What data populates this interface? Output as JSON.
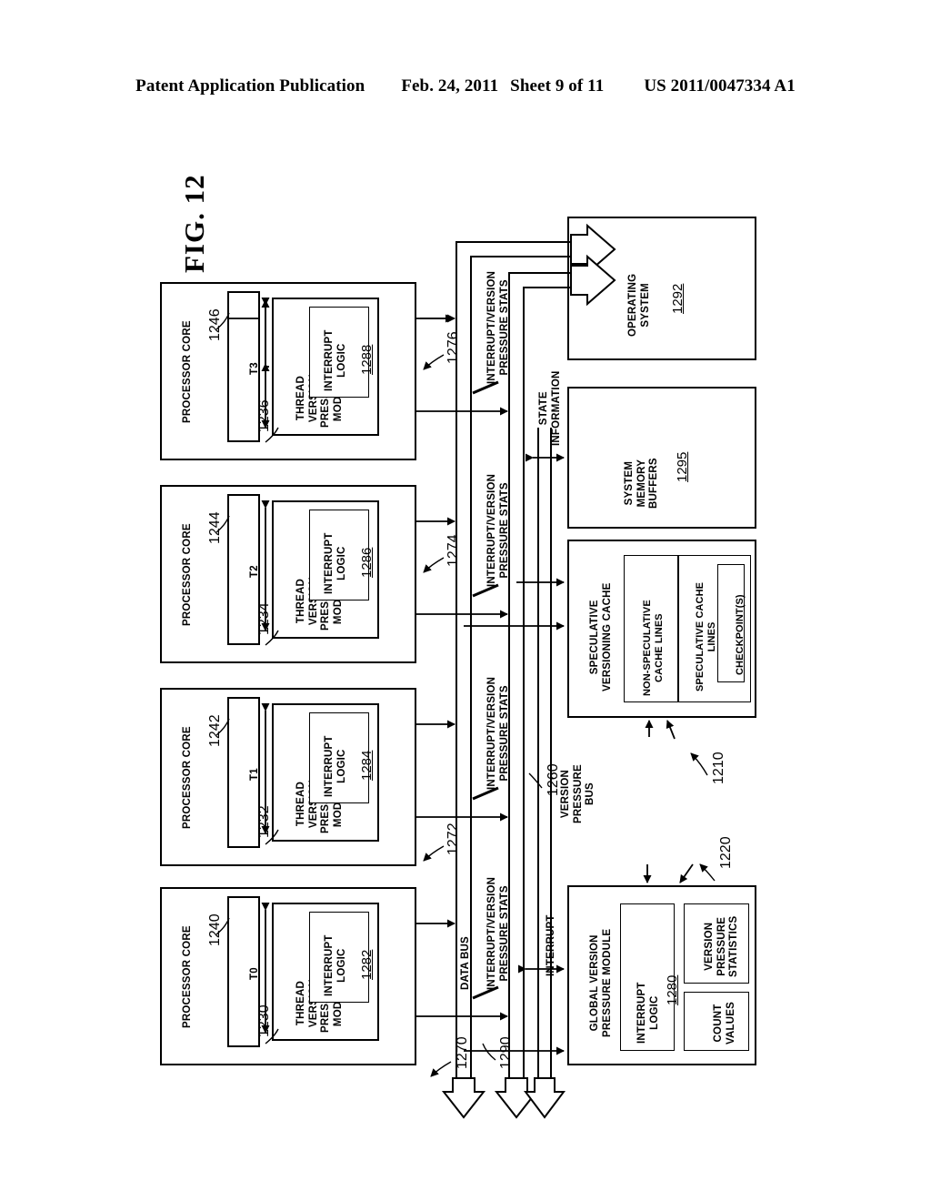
{
  "header": {
    "publication": "Patent Application Publication",
    "date": "Feb. 24, 2011",
    "sheet": "Sheet 9 of 11",
    "patent_number": "US 2011/0047334 A1"
  },
  "figure": {
    "label": "FIG. 12"
  },
  "processor_cores": [
    {
      "title": "PROCESSOR CORE",
      "thread_label": "T3",
      "thread_ref": "1246",
      "module_title": "THREAD VERSION PRESSURE MODULE",
      "module_ref": "1236",
      "interrupt_title": "INTERRUPT LOGIC",
      "interrupt_ref": "1288"
    },
    {
      "title": "PROCESSOR CORE",
      "thread_label": "T2",
      "thread_ref": "1244",
      "module_title": "THREAD VERSION PRESSURE MODULE",
      "module_ref": "1234",
      "interrupt_title": "INTERRUPT LOGIC",
      "interrupt_ref": "1286"
    },
    {
      "title": "PROCESSOR CORE",
      "thread_label": "T1",
      "thread_ref": "1242",
      "module_title": "THREAD VERSION PRESSURE MODULE",
      "module_ref": "1232",
      "interrupt_title": "INTERRUPT LOGIC",
      "interrupt_ref": "1284"
    },
    {
      "title": "PROCESSOR CORE",
      "thread_label": "T0",
      "thread_ref": "1240",
      "module_title": "THREAD VERSION PRESSURE MODULE",
      "module_ref": "1230",
      "interrupt_title": "INTERRUPT LOGIC",
      "interrupt_ref": "1282"
    }
  ],
  "blocks": {
    "operating_system": {
      "title": "OPERATING SYSTEM",
      "ref": "1292"
    },
    "system_memory_buffers": {
      "title": "SYSTEM MEMORY BUFFERS",
      "ref": "1295"
    },
    "speculative_versioning_cache": {
      "title": "SPECULATIVE VERSIONING CACHE",
      "ref": "1210",
      "non_speculative_lines": "NON-SPECULATIVE CACHE LINES",
      "speculative_lines": "SPECULATIVE CACHE LINES",
      "checkpoints": "CHECKPOINT(S)"
    },
    "global_version_pressure_module": {
      "title": "GLOBAL VERSION PRESSURE MODULE",
      "ref": "1220",
      "interrupt_logic_title": "INTERRUPT LOGIC",
      "interrupt_logic_ref": "1280",
      "version_pressure_statistics": "VERSION PRESSURE STATISTICS",
      "count_values": "COUNT VALUES"
    }
  },
  "buses": {
    "data_bus": {
      "label": "DATA BUS",
      "ref": "1270"
    },
    "interrupt_stats_bus": {
      "label": "INTERRUPT/VERSION PRESSURE STATS",
      "ref": "1290"
    },
    "version_pressure_bus": {
      "label": "VERSION PRESSURE BUS",
      "ref": "1260"
    },
    "interrupt_signal": {
      "label": "INTERRUPT"
    },
    "state_information": {
      "label": "STATE INFORMATION"
    },
    "core_stat_links": [
      {
        "label": "INTERRUPT/VERSION PRESSURE STATS",
        "ref": "1276"
      },
      {
        "label": "INTERRUPT/VERSION PRESSURE STATS",
        "ref": "1274"
      },
      {
        "label": "INTERRUPT/VERSION PRESSURE STATS",
        "ref": "1272"
      }
    ]
  }
}
